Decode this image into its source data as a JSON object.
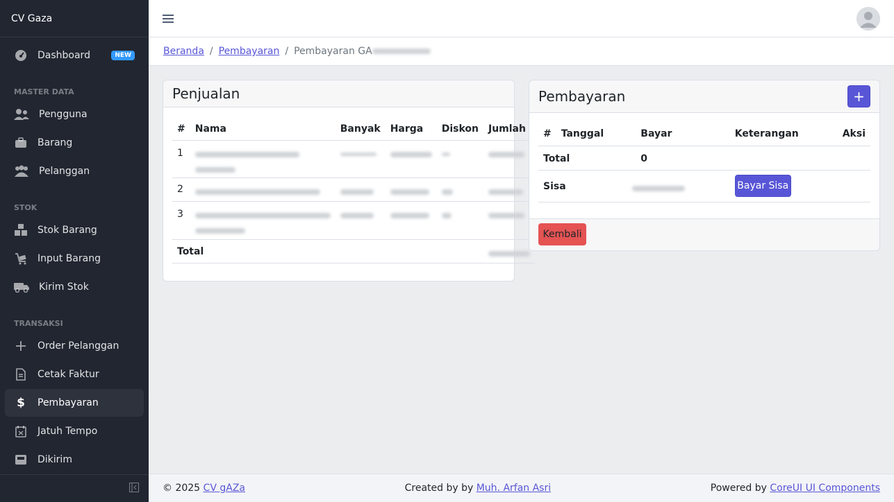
{
  "brand": "CV Gaza",
  "sidebar": {
    "items": [
      {
        "label": "Dashboard",
        "icon": "speedometer-icon",
        "badge": "NEW"
      },
      {
        "section": "MASTER DATA"
      },
      {
        "label": "Pengguna",
        "icon": "users-icon"
      },
      {
        "label": "Barang",
        "icon": "briefcase-icon"
      },
      {
        "label": "Pelanggan",
        "icon": "people-icon"
      },
      {
        "section": "STOK"
      },
      {
        "label": "Stok Barang",
        "icon": "boxes-icon"
      },
      {
        "label": "Input Barang",
        "icon": "cart-icon"
      },
      {
        "label": "Kirim Stok",
        "icon": "truck-icon"
      },
      {
        "section": "TRANSAKSI"
      },
      {
        "label": "Order Pelanggan",
        "icon": "plus-icon"
      },
      {
        "label": "Cetak Faktur",
        "icon": "document-icon"
      },
      {
        "label": "Pembayaran",
        "icon": "dollar-icon",
        "active": true
      },
      {
        "label": "Jatuh Tempo",
        "icon": "calendar-icon"
      },
      {
        "label": "Dikirim",
        "icon": "inbox-icon"
      }
    ]
  },
  "breadcrumb": {
    "home": "Beranda",
    "parent": "Pembayaran",
    "current": "Pembayaran GA"
  },
  "penjualan": {
    "title": "Penjualan",
    "columns": [
      "#",
      "Nama",
      "Banyak",
      "Harga",
      "Diskon",
      "Jumlah"
    ],
    "rows": [
      {
        "no": "1"
      },
      {
        "no": "2"
      },
      {
        "no": "3"
      }
    ],
    "total_label": "Total"
  },
  "pembayaran": {
    "title": "Pembayaran",
    "add_label": "+",
    "columns": [
      "#",
      "Tanggal",
      "Bayar",
      "Keterangan",
      "Aksi"
    ],
    "total_label": "Total",
    "total_value": "0",
    "sisa_label": "Sisa",
    "bayar_sisa_label": "Bayar Sisa",
    "kembali_label": "Kembali"
  },
  "footer": {
    "copyright": "© 2025",
    "company_link": "CV gAZa",
    "created_prefix": "Created by by",
    "author_link": "Muh. Arfan Asri",
    "powered_prefix": "Powered by",
    "powered_link": "CoreUI UI Components"
  },
  "colors": {
    "sidebar_bg": "#212631",
    "primary": "#5856d6",
    "danger": "#e55353",
    "badge": "#3399ff"
  }
}
